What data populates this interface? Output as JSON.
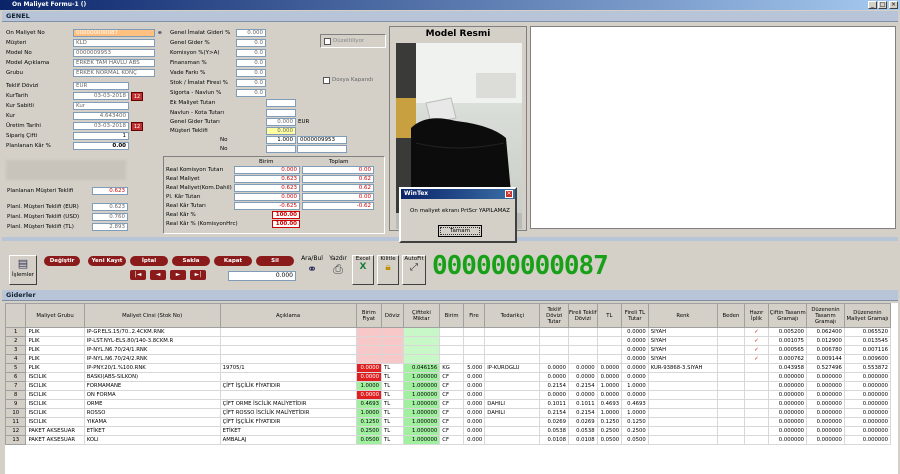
{
  "window": {
    "title": "On Maliyet Formu-1 ()",
    "min": "_",
    "max": "□",
    "close": "×"
  },
  "section_genel": "GENEL",
  "form_left": {
    "on_maliyet_no_label": "On Maliyet No",
    "on_maliyet_no": "000000000087",
    "musteri_label": "Müşteri",
    "musteri": "KLD",
    "model_no_label": "Model No",
    "model_no": "0000009953",
    "model_aciklama_label": "Model Açıklama",
    "model_aciklama": "ERKEK TAM HAVLU ABS",
    "grubu_label": "Grubu",
    "grubu": "ERKEK NORMAL KONÇ",
    "teklif_dovizi_label": "Teklif Dövizi",
    "teklif_dovizi": "EUR",
    "kur_tarih_label": "KurTarih",
    "kur_tarih": "03-03-2018",
    "kur_sabitli_label": "Kur Sabitli",
    "kur_sabitli": "Kur",
    "kur_label": "Kur",
    "kur": "4.643400",
    "uretim_tarihi_label": "Üretim Tarihi",
    "uretim_tarihi": "03-03-2018",
    "siparis_ciftı_label": "Sipariş Çifti",
    "siparis_ciftı": "1",
    "planlanan_kar_label": "Planlanan Kâr %",
    "planlanan_kar": "0.00",
    "cal_icon_1": "12",
    "cal_icon_2": "12"
  },
  "form_mid": {
    "genel_imalat_label": "Genel İmalat Gideri %",
    "genel_imalat": "0.000",
    "genel_gider_label": "Genel Gider %",
    "genel_gider": "0.0",
    "komisyon_label": "Komisyon %(Y>A)",
    "komisyon": "0.0",
    "finansman_label": "Finansman %",
    "finansman": "0.0",
    "vade_label": "Vade Farkı %",
    "vade": "0.0",
    "stok_label": "Stok / İmalat Firesi %",
    "stok": "0.0",
    "sigorta_label": "Sigorta - Navlun %",
    "sigorta": "0.0",
    "ek_maliyet_label": "Ek Maliyet Tutarı",
    "navlun_label": "Navlun - Kota Tutarı",
    "genel_gider_tutari_label": "Genel Gider Tutarı",
    "genel_gider_tutari": "0.000",
    "genel_gider_cur": "EUR",
    "musteri_teklif_label": "Müşteri Teklifi",
    "musteri_teklif": "0.000",
    "no_label_1": "No",
    "no_val_1": "1.000",
    "no_code_1": "0000009953",
    "no_label_2": "No",
    "duzeltiliyor": "Düzeltiliyor",
    "dosya_kapandi": "Dosya Kapandı"
  },
  "summary": {
    "birim_header": "Birim",
    "toplam_header": "Toplam",
    "rows": [
      {
        "label": "Real Komisyon Tutarı",
        "birim": "0.000",
        "toplam": "0.00"
      },
      {
        "label": "Real Maliyet",
        "birim": "0.623",
        "toplam": "0.62"
      },
      {
        "label": "Real Maliyet(Kom.Dahil)",
        "birim": "0.623",
        "toplam": "0.62"
      },
      {
        "label": "Pl. Kâr Tutarı",
        "birim": "0.000",
        "toplam": "0.00"
      },
      {
        "label": "Real Kâr Tutarı",
        "birim": "-0.625",
        "toplam": "-0.62"
      },
      {
        "label": "Real  Kâr %",
        "birim": "100.00",
        "toplam": ""
      },
      {
        "label": "Real  Kâr % (KomisyonHrc)",
        "birim": "100.00",
        "toplam": ""
      }
    ],
    "planlanan_musteri_label": "Planlanan Müşteri Teklifi",
    "planlanan_musteri": "0.623",
    "planl_eur_label": "Planl. Müşteri Teklifi  (EUR)",
    "planl_eur": "0.623",
    "planl_usd_label": "Planl. Müşteri Teklifi  (USD)",
    "planl_usd": "0.760",
    "planl_tl_label": "Planl. Müşteri Teklifi  (TL)",
    "planl_tl": "2.893"
  },
  "model_resmi": "Model Resmi",
  "dialog": {
    "title": "WinTex",
    "message": "On maliyet ekranı PrtScr YAPILAMAZ",
    "ok": "Tamam"
  },
  "toolbar": {
    "islemler": "İşlemler",
    "degistir": "Değiştir",
    "yeni_kayit": "Yeni Kayıt",
    "iptal": "İptal",
    "sakla": "Sakla",
    "kapat": "Kapat",
    "sil": "Sil",
    "ara_bul": "Ara/Bul",
    "yazdir": "Yazdır",
    "excel": "Excel",
    "kilitle": "Kilitle",
    "autofit": "AutoFit",
    "counter": "0.000",
    "record_no": "000000000087",
    "nav_first": "|◄",
    "nav_prev": "◄",
    "nav_next": "►",
    "nav_last": "►|"
  },
  "giderler": {
    "title": "Giderler",
    "columns": [
      "Maliyet Grubu",
      "Maliyet Cinsi (Stok No)",
      "Açıklama",
      "Birim Fiyat",
      "Döviz",
      "Çiftteki Miktar",
      "Birim",
      "Fire",
      "Tedarikçi",
      "Teklif Dövizi Tutar",
      "Fireli Teklif Dövizi",
      "TL",
      "Fireli TL Tutar",
      "Renk",
      "Beden",
      "Hazır İplik",
      "Çiftin Tasarım Gramajı",
      "Düzenenin Tasarım Gramajı",
      "Düzenenin Maliyet Gramajı"
    ],
    "rows": [
      {
        "n": "1",
        "grp": "PLIK",
        "cins": "IP-GP.ELS.15/70..2.4CKM.RNK",
        "aciklama": "",
        "fiyat": "",
        "doviz": "",
        "miktar": "",
        "birim": "",
        "fire": "",
        "ted": "",
        "tdt": "",
        "ftd": "",
        "tl": "",
        "ftl": "0.0000",
        "renk": "SIYAH",
        "beden": "",
        "hazir": "✓",
        "ctg": "0.005200",
        "dtg": "0.062400",
        "dmg": "0.065520"
      },
      {
        "n": "2",
        "grp": "PLIK",
        "cins": "IP-LST.NYL-ELS.80/140-3.8CKM.R",
        "aciklama": "",
        "fiyat": "",
        "doviz": "",
        "miktar": "",
        "birim": "",
        "fire": "",
        "ted": "",
        "tdt": "",
        "ftd": "",
        "tl": "",
        "ftl": "0.0000",
        "renk": "SIYAH",
        "beden": "",
        "hazir": "✓",
        "ctg": "0.001075",
        "dtg": "0.012900",
        "dmg": "0.013545"
      },
      {
        "n": "3",
        "grp": "PLIK",
        "cins": "IP-NYL.N6.70/24/1.RNK",
        "aciklama": "",
        "fiyat": "",
        "doviz": "",
        "miktar": "",
        "birim": "",
        "fire": "",
        "ted": "",
        "tdt": "",
        "ftd": "",
        "tl": "",
        "ftl": "0.0000",
        "renk": "SIYAH",
        "beden": "",
        "hazir": "✓",
        "ctg": "0.000565",
        "dtg": "0.006780",
        "dmg": "0.007116"
      },
      {
        "n": "4",
        "grp": "PLIK",
        "cins": "IP-NYL.N6.70/24/2.RNK",
        "aciklama": "",
        "fiyat": "",
        "doviz": "",
        "miktar": "",
        "birim": "",
        "fire": "",
        "ted": "",
        "tdt": "",
        "ftd": "",
        "tl": "",
        "ftl": "0.0000",
        "renk": "SIYAH",
        "beden": "",
        "hazir": "✓",
        "ctg": "0.000762",
        "dtg": "0.009144",
        "dmg": "0.009600"
      },
      {
        "n": "5",
        "grp": "PLIK",
        "cins": "IP-PNY.20/1.%100.RNK",
        "aciklama": "19705/1",
        "fiyat": "0.0000",
        "doviz": "TL",
        "miktar": "0.046156",
        "birim": "KG",
        "fire": "5.000",
        "ted": "IP-KUROGLU",
        "tdt": "0.0000",
        "ftd": "0.0000",
        "tl": "0.0000",
        "ftl": "0.0000",
        "renk": "KUR-93868-3.SIYAH",
        "beden": "",
        "hazir": "",
        "ctg": "0.043958",
        "dtg": "0.527496",
        "dmg": "0.553872"
      },
      {
        "n": "6",
        "grp": "ISCILIK",
        "cins": "BASKI(ABS-SILKON)",
        "aciklama": "",
        "fiyat": "0.0000",
        "doviz": "TL",
        "miktar": "1.000000",
        "birim": "CF",
        "fire": "0.000",
        "ted": "",
        "tdt": "0.0000",
        "ftd": "0.0000",
        "tl": "0.0000",
        "ftl": "0.0000",
        "renk": "",
        "beden": "",
        "hazir": "",
        "ctg": "0.000000",
        "dtg": "0.000000",
        "dmg": "0.000000"
      },
      {
        "n": "7",
        "grp": "ISCILIK",
        "cins": "FORMAMANE",
        "aciklama": "ÇİFT İŞÇİLİK FİYATIDIR",
        "fiyat": "1.0000",
        "doviz": "TL",
        "miktar": "1.000000",
        "birim": "CF",
        "fire": "0.000",
        "ted": "",
        "tdt": "0.2154",
        "ftd": "0.2154",
        "tl": "1.0000",
        "ftl": "1.0000",
        "renk": "",
        "beden": "",
        "hazir": "",
        "ctg": "0.000000",
        "dtg": "0.000000",
        "dmg": "0.000000"
      },
      {
        "n": "8",
        "grp": "ISCILIK",
        "cins": "ON FORMA",
        "aciklama": "",
        "fiyat": "0.0000",
        "doviz": "TL",
        "miktar": "1.000000",
        "birim": "CF",
        "fire": "0.000",
        "ted": "",
        "tdt": "0.0000",
        "ftd": "0.0000",
        "tl": "0.0000",
        "ftl": "0.0000",
        "renk": "",
        "beden": "",
        "hazir": "",
        "ctg": "0.000000",
        "dtg": "0.000000",
        "dmg": "0.000000"
      },
      {
        "n": "9",
        "grp": "ISCILIK",
        "cins": "ORME",
        "aciklama": "ÇİFT ORME İSCİLİK MALİYETİDIR",
        "fiyat": "0.4693",
        "doviz": "TL",
        "miktar": "1.000000",
        "birim": "CF",
        "fire": "0.000",
        "ted": "DAHILI",
        "tdt": "0.1011",
        "ftd": "0.1011",
        "tl": "0.4693",
        "ftl": "0.4693",
        "renk": "",
        "beden": "",
        "hazir": "",
        "ctg": "0.000000",
        "dtg": "0.000000",
        "dmg": "0.000000"
      },
      {
        "n": "10",
        "grp": "ISCILIK",
        "cins": "ROSSO",
        "aciklama": "ÇİFT ROSSO İSCİLİK MALİYETİDIR",
        "fiyat": "1.0000",
        "doviz": "TL",
        "miktar": "1.000000",
        "birim": "CF",
        "fire": "0.000",
        "ted": "DAHILI",
        "tdt": "0.2154",
        "ftd": "0.2154",
        "tl": "1.0000",
        "ftl": "1.0000",
        "renk": "",
        "beden": "",
        "hazir": "",
        "ctg": "0.000000",
        "dtg": "0.000000",
        "dmg": "0.000000"
      },
      {
        "n": "11",
        "grp": "ISCILIK",
        "cins": "YIKAMA",
        "aciklama": "ÇİFT İŞÇİLİK FİYATIDIR",
        "fiyat": "0.1250",
        "doviz": "TL",
        "miktar": "1.000000",
        "birim": "CF",
        "fire": "0.000",
        "ted": "",
        "tdt": "0.0269",
        "ftd": "0.0269",
        "tl": "0.1250",
        "ftl": "0.1250",
        "renk": "",
        "beden": "",
        "hazir": "",
        "ctg": "0.000000",
        "dtg": "0.000000",
        "dmg": "0.000000"
      },
      {
        "n": "12",
        "grp": "PAKET AKSESUAR",
        "cins": "ETİKET",
        "aciklama": "ETİKET",
        "fiyat": "0.2500",
        "doviz": "TL",
        "miktar": "1.000000",
        "birim": "CF",
        "fire": "0.000",
        "ted": "",
        "tdt": "0.0538",
        "ftd": "0.0538",
        "tl": "0.2500",
        "ftl": "0.2500",
        "renk": "",
        "beden": "",
        "hazir": "",
        "ctg": "0.000000",
        "dtg": "0.000000",
        "dmg": "0.000000"
      },
      {
        "n": "13",
        "grp": "PAKET AKSESUAR",
        "cins": "KOLI",
        "aciklama": "AMBALAJ",
        "fiyat": "0.0500",
        "doviz": "TL",
        "miktar": "1.000000",
        "birim": "CF",
        "fire": "0.000",
        "ted": "",
        "tdt": "0.0108",
        "ftd": "0.0108",
        "tl": "0.0500",
        "ftl": "0.0500",
        "renk": "",
        "beden": "",
        "hazir": "",
        "ctg": "0.000000",
        "dtg": "0.000000",
        "dmg": "0.000000"
      }
    ]
  }
}
